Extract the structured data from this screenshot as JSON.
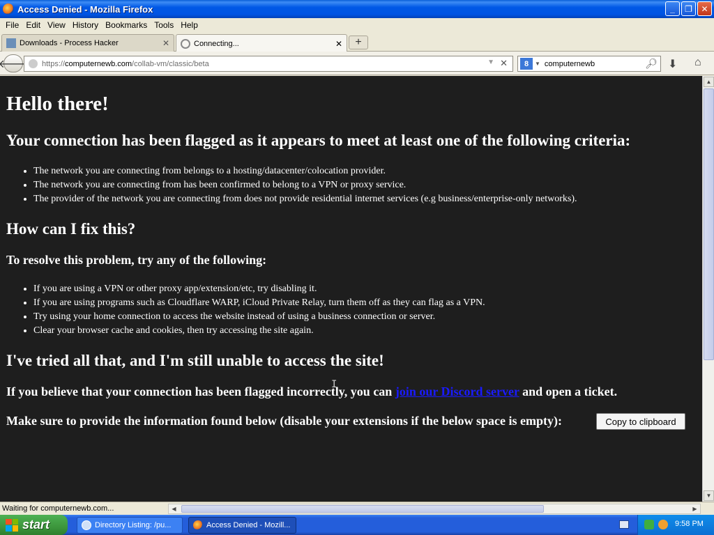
{
  "window": {
    "title": "Access Denied - Mozilla Firefox"
  },
  "menu": [
    "File",
    "Edit",
    "View",
    "History",
    "Bookmarks",
    "Tools",
    "Help"
  ],
  "tabs": [
    {
      "label": "Downloads - Process Hacker",
      "active": false
    },
    {
      "label": "Connecting...",
      "active": true
    }
  ],
  "nav": {
    "url_scheme": "https://",
    "url_host": "computernewb.com",
    "url_path": "/collab-vm/classic/beta",
    "search_engine": "8",
    "search_value": "computernewb"
  },
  "page": {
    "heading": "Hello there!",
    "criteria_heading": "Your connection has been flagged as it appears to meet at least one of the following criteria:",
    "criteria": [
      "The network you are connecting from belongs to a hosting/datacenter/colocation provider.",
      "The network you are connecting from has been confirmed to belong to a VPN or proxy service.",
      "The provider of the network you are connecting from does not provide residential internet services (e.g business/enterprise-only networks)."
    ],
    "fix_heading": "How can I fix this?",
    "resolve_heading": "To resolve this problem, try any of the following:",
    "fixes": [
      "If you are using a VPN or other proxy app/extension/etc, try disabling it.",
      "If you are using programs such as Cloudflare WARP, iCloud Private Relay, turn them off as they can flag as a VPN.",
      "Try using your home connection to access the website instead of using a business connection or server.",
      "Clear your browser cache and cookies, then try accessing the site again."
    ],
    "tried_heading": "I've tried all that, and I'm still unable to access the site!",
    "ticket_before": "If you believe that your connection has been flagged incorrectly, you can",
    "ticket_link": "join our Discord server",
    "ticket_after": "and open a ticket.",
    "provide_info": "Make sure to provide the information found below (disable your extensions if the below space is empty):",
    "copy_button": "Copy to clipboard"
  },
  "status": {
    "text": "Waiting for computernewb.com..."
  },
  "taskbar": {
    "start_label": "start",
    "items": [
      {
        "label": "Directory Listing: /pu...",
        "active": false
      },
      {
        "label": "Access Denied - Mozill...",
        "active": true
      }
    ],
    "clock": "9:58 PM"
  },
  "colors": {
    "page_background": "#1e1e1e",
    "link": "#1a1aff",
    "xp_blue": "#245edb"
  }
}
